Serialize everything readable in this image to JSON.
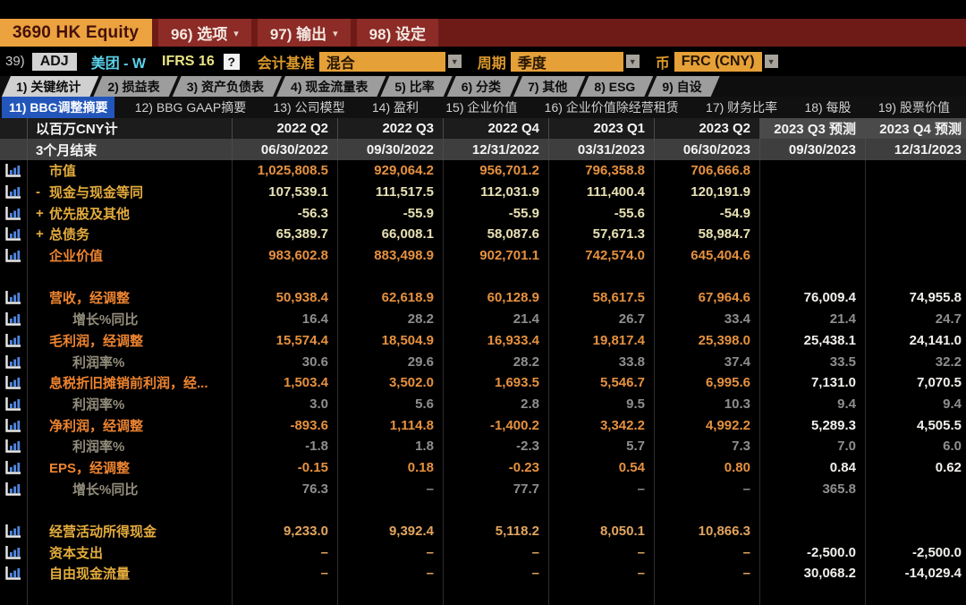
{
  "titlebar": {
    "ticker": "3690 HK Equity",
    "menus": [
      {
        "num": "96)",
        "label": "选项",
        "arrow": true
      },
      {
        "num": "97)",
        "label": "输出",
        "arrow": true
      },
      {
        "num": "98)",
        "label": "设定",
        "arrow": false
      }
    ]
  },
  "toolbar": {
    "row_num": "39)",
    "adj_badge": "ADJ",
    "company": "美团 - W",
    "standard": "IFRS 16",
    "help_icon": "?",
    "basis_label": "会计基准",
    "basis_value": "混合",
    "period_label": "周期",
    "period_value": "季度",
    "currency_label": "币",
    "currency_value": "FRC (CNY)"
  },
  "icons": {
    "dropdown_arrow": "▼",
    "menu_arrow": "▾"
  },
  "colors": {
    "accent_amber": "#eca33f",
    "bar_red": "#6e1b18",
    "active_tab_blue": "#2356bb",
    "value_orange": "#e6913f",
    "value_pale": "#e8e1b4",
    "forecast_white": "#f2f0ec"
  },
  "tabs_primary": [
    {
      "label": "1) 关键统计",
      "active": true
    },
    {
      "label": "2) 损益表",
      "active": false
    },
    {
      "label": "3) 资产负债表",
      "active": false
    },
    {
      "label": "4) 现金流量表",
      "active": false
    },
    {
      "label": "5) 比率",
      "active": false
    },
    {
      "label": "6) 分类",
      "active": false
    },
    {
      "label": "7) 其他",
      "active": false
    },
    {
      "label": "8) ESG",
      "active": false
    },
    {
      "label": "9) 自设",
      "active": false
    }
  ],
  "tabs_secondary": [
    {
      "label": "11) BBG调整摘要",
      "active": true
    },
    {
      "label": "12) BBG GAAP摘要",
      "active": false
    },
    {
      "label": "13) 公司模型",
      "active": false
    },
    {
      "label": "14) 盈利",
      "active": false
    },
    {
      "label": "15) 企业价值",
      "active": false
    },
    {
      "label": "16) 企业价值除经营租赁",
      "active": false
    },
    {
      "label": "17) 财务比率",
      "active": false
    },
    {
      "label": "18) 每股",
      "active": false
    },
    {
      "label": "19) 股票价值",
      "active": false
    }
  ],
  "table": {
    "unit_label": "以百万CNY计",
    "period_label": "3个月结束",
    "columns": [
      {
        "quarter": "2022 Q2",
        "date": "06/30/2022",
        "forecast": false
      },
      {
        "quarter": "2022 Q3",
        "date": "09/30/2022",
        "forecast": false
      },
      {
        "quarter": "2022 Q4",
        "date": "12/31/2022",
        "forecast": false
      },
      {
        "quarter": "2023 Q1",
        "date": "03/31/2023",
        "forecast": false
      },
      {
        "quarter": "2023 Q2",
        "date": "06/30/2023",
        "forecast": false
      },
      {
        "quarter": "2023 Q3 预测",
        "date": "09/30/2023",
        "forecast": true
      },
      {
        "quarter": "2023 Q4 预测",
        "date": "12/31/2023",
        "forecast": true
      }
    ],
    "rows": [
      {
        "prefix": "",
        "indent": 0,
        "label": "市值",
        "label_style": "amber",
        "value_style": "orange",
        "values": [
          "1,025,808.5",
          "929,064.2",
          "956,701.2",
          "796,358.8",
          "706,666.8",
          "",
          ""
        ]
      },
      {
        "prefix": "-",
        "indent": 0,
        "label": "现金与现金等同",
        "label_style": "amber",
        "value_style": "pale",
        "values": [
          "107,539.1",
          "111,517.5",
          "112,031.9",
          "111,400.4",
          "120,191.9",
          "",
          ""
        ]
      },
      {
        "prefix": "+",
        "indent": 0,
        "label": "优先股及其他",
        "label_style": "amber",
        "value_style": "pale",
        "values": [
          "-56.3",
          "-55.9",
          "-55.9",
          "-55.6",
          "-54.9",
          "",
          ""
        ]
      },
      {
        "prefix": "+",
        "indent": 0,
        "label": "总债务",
        "label_style": "amber",
        "value_style": "pale",
        "values": [
          "65,389.7",
          "66,008.1",
          "58,087.6",
          "57,671.3",
          "58,984.7",
          "",
          ""
        ]
      },
      {
        "prefix": "",
        "indent": 0,
        "label": "企业价值",
        "label_style": "orange",
        "value_style": "orange",
        "values": [
          "983,602.8",
          "883,498.9",
          "902,701.1",
          "742,574.0",
          "645,404.6",
          "",
          ""
        ]
      },
      {
        "type": "spacer"
      },
      {
        "prefix": "",
        "indent": 0,
        "label": "营收，经调整",
        "label_style": "orange",
        "value_style": "orange",
        "values": [
          "50,938.4",
          "62,618.9",
          "60,128.9",
          "58,617.5",
          "67,964.6",
          "76,009.4",
          "74,955.8"
        ]
      },
      {
        "prefix": "",
        "indent": 1,
        "label": "增长%同比",
        "label_style": "gray",
        "value_style": "gray",
        "values": [
          "16.4",
          "28.2",
          "21.4",
          "26.7",
          "33.4",
          "21.4",
          "24.7"
        ]
      },
      {
        "prefix": "",
        "indent": 0,
        "label": "毛利润，经调整",
        "label_style": "orange",
        "value_style": "orange",
        "values": [
          "15,574.4",
          "18,504.9",
          "16,933.4",
          "19,817.4",
          "25,398.0",
          "25,438.1",
          "24,141.0"
        ]
      },
      {
        "prefix": "",
        "indent": 1,
        "label": "利润率%",
        "label_style": "gray",
        "value_style": "gray",
        "values": [
          "30.6",
          "29.6",
          "28.2",
          "33.8",
          "37.4",
          "33.5",
          "32.2"
        ]
      },
      {
        "prefix": "",
        "indent": 0,
        "label": "息税折旧摊销前利润，经...",
        "label_style": "orange",
        "value_style": "orange",
        "values": [
          "1,503.4",
          "3,502.0",
          "1,693.5",
          "5,546.7",
          "6,995.6",
          "7,131.0",
          "7,070.5"
        ]
      },
      {
        "prefix": "",
        "indent": 1,
        "label": "利润率%",
        "label_style": "gray",
        "value_style": "gray",
        "values": [
          "3.0",
          "5.6",
          "2.8",
          "9.5",
          "10.3",
          "9.4",
          "9.4"
        ]
      },
      {
        "prefix": "",
        "indent": 0,
        "label": "净利润，经调整",
        "label_style": "orange",
        "value_style": "orange",
        "values": [
          "-893.6",
          "1,114.8",
          "-1,400.2",
          "3,342.2",
          "4,992.2",
          "5,289.3",
          "4,505.5"
        ]
      },
      {
        "prefix": "",
        "indent": 1,
        "label": "利润率%",
        "label_style": "gray",
        "value_style": "gray",
        "values": [
          "-1.8",
          "1.8",
          "-2.3",
          "5.7",
          "7.3",
          "7.0",
          "6.0"
        ]
      },
      {
        "prefix": "",
        "indent": 0,
        "label": "EPS，经调整",
        "label_style": "orange",
        "value_style": "orange",
        "values": [
          "-0.15",
          "0.18",
          "-0.23",
          "0.54",
          "0.80",
          "0.84",
          "0.62"
        ]
      },
      {
        "prefix": "",
        "indent": 1,
        "label": "增长%同比",
        "label_style": "gray",
        "value_style": "gray",
        "values": [
          "76.3",
          "–",
          "77.7",
          "–",
          "–",
          "365.8",
          ""
        ]
      },
      {
        "type": "spacer"
      },
      {
        "prefix": "",
        "indent": 0,
        "label": "经营活动所得现金",
        "label_style": "amber",
        "value_style": "cash",
        "values": [
          "9,233.0",
          "9,392.4",
          "5,118.2",
          "8,050.1",
          "10,866.3",
          "",
          ""
        ]
      },
      {
        "prefix": "",
        "indent": 0,
        "label": "资本支出",
        "label_style": "amber",
        "value_style": "cash",
        "values": [
          "–",
          "–",
          "–",
          "–",
          "–",
          "-2,500.0",
          "-2,500.0"
        ]
      },
      {
        "prefix": "",
        "indent": 0,
        "label": "自由现金流量",
        "label_style": "amber",
        "value_style": "cash",
        "values": [
          "–",
          "–",
          "–",
          "–",
          "–",
          "30,068.2",
          "-14,029.4"
        ]
      }
    ]
  }
}
